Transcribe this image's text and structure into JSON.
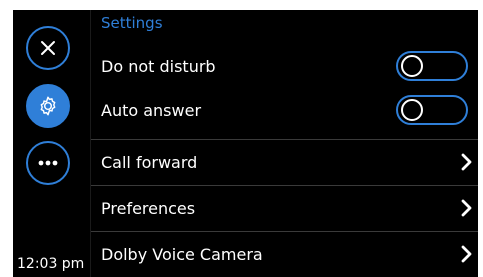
{
  "status": {
    "time": "12:03 pm"
  },
  "rail": {
    "close": {
      "icon": "close-icon"
    },
    "settings": {
      "icon": "gear-icon",
      "active": true
    },
    "more": {
      "icon": "more-dots-icon"
    }
  },
  "settings": {
    "title": "Settings",
    "toggles": [
      {
        "label": "Do not disturb",
        "on": false
      },
      {
        "label": "Auto answer",
        "on": false
      }
    ],
    "links": [
      {
        "label": "Call forward",
        "icon": "chevron-right-icon"
      },
      {
        "label": "Preferences",
        "icon": "chevron-right-icon"
      },
      {
        "label": "Dolby Voice Camera",
        "icon": "chevron-right-icon"
      }
    ]
  },
  "colors": {
    "accent": "#2f7fd8",
    "background": "#000000",
    "text": "#ffffff",
    "divider": "#3a3a3a"
  }
}
